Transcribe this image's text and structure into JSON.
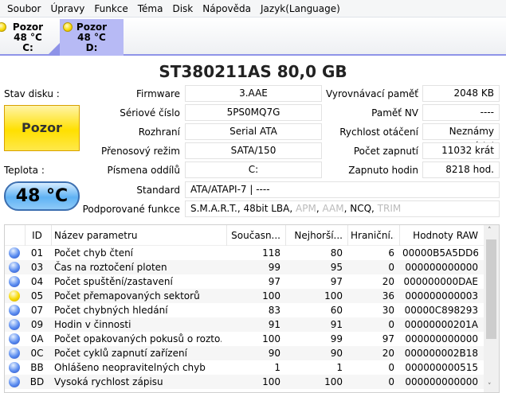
{
  "menu": [
    "Soubor",
    "Úpravy",
    "Funkce",
    "Téma",
    "Disk",
    "Nápověda",
    "Jazyk(Language)"
  ],
  "disk_tabs": [
    {
      "status": "Pozor",
      "temp": "48 °C",
      "drive": "C:",
      "selected": false
    },
    {
      "status": "Pozor",
      "temp": "48 °C",
      "drive": "D:",
      "selected": true
    }
  ],
  "title": "ST380211AS  80,0 GB",
  "status_label": "Stav disku :",
  "status_value": "Pozor",
  "temp_label": "Teplota :",
  "temp_value": "48 °C",
  "left_info": [
    {
      "label": "Firmware",
      "value": "3.AAE"
    },
    {
      "label": "Sériové číslo",
      "value": "5PS0MQ7G"
    },
    {
      "label": "Rozhraní",
      "value": "Serial ATA"
    },
    {
      "label": "Přenosový režim",
      "value": "SATA/150"
    },
    {
      "label": "Písmena oddílů",
      "value": "C:"
    }
  ],
  "right_info": [
    {
      "label": "Vyrovnávací paměť",
      "value": "2048 KB"
    },
    {
      "label": "Paměť NV",
      "value": "----"
    },
    {
      "label": "Rychlost otáčení",
      "value": "Neznámy údaj"
    },
    {
      "label": "Počet zapnutí",
      "value": "11032 krát"
    },
    {
      "label": "Zapnuto hodin",
      "value": "8218 hod."
    }
  ],
  "standard": {
    "label": "Standard",
    "value": "ATA/ATAPI-7 | ----"
  },
  "features": {
    "label": "Podporované funkce",
    "items": [
      {
        "name": "S.M.A.R.T.",
        "enabled": true
      },
      {
        "name": "48bit LBA",
        "enabled": true
      },
      {
        "name": "APM",
        "enabled": false
      },
      {
        "name": "AAM",
        "enabled": false
      },
      {
        "name": "NCQ",
        "enabled": true
      },
      {
        "name": "TRIM",
        "enabled": false
      }
    ]
  },
  "table": {
    "headers": [
      "ID",
      "Název parametru",
      "Současn...",
      "Nejhorší...",
      "Hraniční...",
      "Hodnoty RAW"
    ],
    "rows": [
      {
        "status": "blue",
        "id": "01",
        "name": "Počet chyb čtení",
        "cur": "118",
        "worst": "80",
        "thr": "6",
        "raw": "00000B5A5DD6"
      },
      {
        "status": "blue",
        "id": "03",
        "name": "Čas na roztočení ploten",
        "cur": "99",
        "worst": "95",
        "thr": "0",
        "raw": "000000000000"
      },
      {
        "status": "blue",
        "id": "04",
        "name": "Počet spuštění/zastavení",
        "cur": "97",
        "worst": "97",
        "thr": "20",
        "raw": "000000000DAE"
      },
      {
        "status": "yellow",
        "id": "05",
        "name": "Počet přemapovaných sektorů",
        "cur": "100",
        "worst": "100",
        "thr": "36",
        "raw": "000000000003"
      },
      {
        "status": "blue",
        "id": "07",
        "name": "Počet chybných hledání",
        "cur": "83",
        "worst": "60",
        "thr": "30",
        "raw": "00000C898293"
      },
      {
        "status": "blue",
        "id": "09",
        "name": "Hodin v činnosti",
        "cur": "91",
        "worst": "91",
        "thr": "0",
        "raw": "00000000201A"
      },
      {
        "status": "blue",
        "id": "0A",
        "name": "Počet opakovaných pokusů o rozto...",
        "cur": "100",
        "worst": "99",
        "thr": "97",
        "raw": "000000000000"
      },
      {
        "status": "blue",
        "id": "0C",
        "name": "Počet cyklů zapnutí zařízení",
        "cur": "90",
        "worst": "90",
        "thr": "20",
        "raw": "000000002B18"
      },
      {
        "status": "blue",
        "id": "BB",
        "name": "Ohlášeno neopravitelných chyb",
        "cur": "1",
        "worst": "1",
        "thr": "0",
        "raw": "000000000515"
      },
      {
        "status": "blue",
        "id": "BD",
        "name": "Vysoká rychlost zápisu",
        "cur": "100",
        "worst": "100",
        "thr": "0",
        "raw": "000000000000"
      }
    ]
  }
}
